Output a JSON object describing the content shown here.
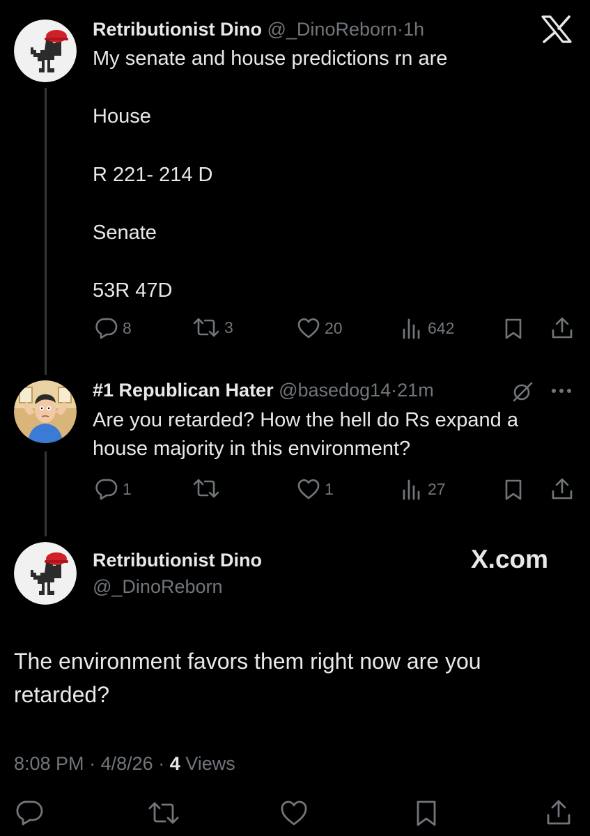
{
  "tweet1": {
    "display_name": "Retributionist Dino",
    "handle": "@_DinoReborn",
    "sep": "·",
    "time": "1h",
    "lines": [
      "My senate and house predictions rn are",
      "House",
      "R 221- 214 D",
      "Senate",
      "53R 47D"
    ],
    "stats": {
      "replies": "8",
      "reposts": "3",
      "likes": "20",
      "views": "642"
    }
  },
  "tweet2": {
    "display_name": "#1 Republican Hater",
    "handle": "@basedog14",
    "sep": "·",
    "time": "21m",
    "lines": [
      "Are you retarded? How the hell do Rs expand a",
      "house majority in this environment?"
    ],
    "stats": {
      "replies": "1",
      "reposts": "",
      "likes": "1",
      "views": "27"
    }
  },
  "tweet3": {
    "display_name": "Retributionist Dino",
    "handle": "@_DinoReborn",
    "watermark": "X.com",
    "lines": [
      "The environment favors them right now are you",
      "retarded?"
    ],
    "time": "8:08 PM",
    "sep1": "·",
    "date": "4/8/26",
    "sep2": "·",
    "views_count": "4",
    "views_label": "Views"
  },
  "colors": {
    "background": "#000000",
    "text": "#e7e9ea",
    "muted": "#71767b",
    "thread_line": "#333639",
    "maga_hat": "#d0202a"
  },
  "icons": [
    "x-logo-icon",
    "reply-icon",
    "repost-icon",
    "like-icon",
    "views-icon",
    "bookmark-icon",
    "share-icon",
    "grok-icon",
    "more-icon"
  ]
}
